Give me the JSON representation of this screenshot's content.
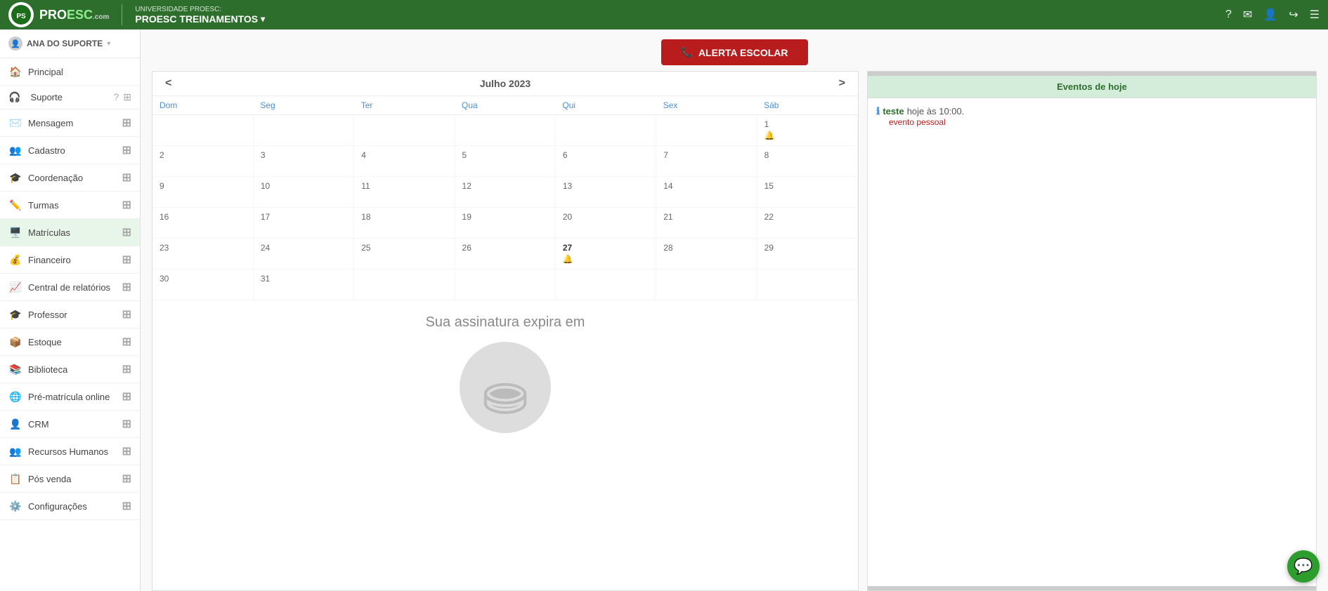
{
  "header": {
    "subtitle": "UNIVERSIDADE PROESC:",
    "title": "PROESC TREINAMENTOS",
    "logo_text_pro": "PRO",
    "logo_text_esc": "ESC",
    "logo_sub": ".com"
  },
  "sidebar": {
    "user_name": "ANA DO SUPORTE",
    "items": [
      {
        "label": "Principal",
        "icon": "🏠",
        "color": "icon-green"
      },
      {
        "label": "Suporte",
        "icon": "🎧",
        "color": "icon-green"
      },
      {
        "label": "Mensagem",
        "icon": "✉️",
        "color": "icon-green"
      },
      {
        "label": "Cadastro",
        "icon": "👥",
        "color": "icon-green"
      },
      {
        "label": "Coordenação",
        "icon": "🎓",
        "color": "icon-green"
      },
      {
        "label": "Turmas",
        "icon": "✏️",
        "color": "icon-green"
      },
      {
        "label": "Matrículas",
        "icon": "🖥️",
        "color": "icon-green"
      },
      {
        "label": "Financeiro",
        "icon": "💰",
        "color": "icon-green"
      },
      {
        "label": "Central de relatórios",
        "icon": "📈",
        "color": "icon-green"
      },
      {
        "label": "Professor",
        "icon": "🎓",
        "color": "icon-green"
      },
      {
        "label": "Estoque",
        "icon": "📦",
        "color": "icon-green"
      },
      {
        "label": "Biblioteca",
        "icon": "📚",
        "color": "icon-green"
      },
      {
        "label": "Pré-matrícula online",
        "icon": "🌐",
        "color": "icon-green"
      },
      {
        "label": "CRM",
        "icon": "👤",
        "color": "icon-green"
      },
      {
        "label": "Recursos Humanos",
        "icon": "👥",
        "color": "icon-green"
      },
      {
        "label": "Pós venda",
        "icon": "📋",
        "color": "icon-green"
      },
      {
        "label": "Configurações",
        "icon": "⚙️",
        "color": "icon-green"
      }
    ]
  },
  "alert_button": "ALERTA ESCOLAR",
  "calendar": {
    "month_title": "Julho 2023",
    "days": [
      "Dom",
      "Seg",
      "Ter",
      "Qua",
      "Qui",
      "Sex",
      "Sab"
    ],
    "weeks": [
      [
        "",
        "",
        "",
        "",
        "",
        "",
        "1"
      ],
      [
        "2",
        "3",
        "4",
        "5",
        "6",
        "7",
        "8"
      ],
      [
        "9",
        "10",
        "11",
        "12",
        "13",
        "14",
        "15"
      ],
      [
        "16",
        "17",
        "18",
        "19",
        "20",
        "21",
        "22"
      ],
      [
        "23",
        "24",
        "25",
        "26",
        "27",
        "28",
        "29"
      ],
      [
        "30",
        "31",
        "",
        "",
        "",
        "",
        ""
      ]
    ],
    "bell_days": [
      "1",
      "27"
    ]
  },
  "events": {
    "header": "Eventos de hoje",
    "items": [
      {
        "name": "teste",
        "time": "hoje às 10:00.",
        "type": "evento pessoal"
      }
    ]
  },
  "subscription_text": "Sua assinatura expira em"
}
